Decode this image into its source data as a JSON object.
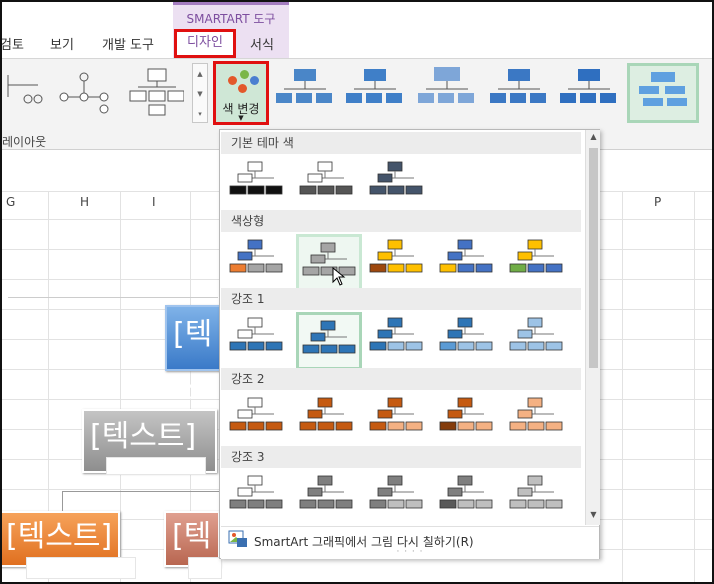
{
  "ribbon_tabs": {
    "review": "검토",
    "view": "보기",
    "developer": "개발 도구",
    "context_group": "SMARTART 도구",
    "design": "디자인",
    "format": "서식"
  },
  "ribbon": {
    "layouts_group": "레이아웃",
    "change_colors": "색 변경"
  },
  "sheet": {
    "columns": [
      "G",
      "H",
      "I",
      "P"
    ],
    "smartart_text": "[텍스트]"
  },
  "gallery": {
    "sections": [
      {
        "title": "기본 테마 색",
        "colors": [
          [
            "#ffffff",
            "#111111",
            "#111111"
          ],
          [
            "#ffffff",
            "#555555",
            "#555555"
          ],
          [
            "#44546a",
            "#44546a",
            "#44546a"
          ]
        ]
      },
      {
        "title": "색상형",
        "colors": [
          [
            "#4472c4",
            "#ed7d31",
            "#a5a5a5"
          ],
          [
            "#a5a5a5",
            "#a5a5a5",
            "#a5a5a5"
          ],
          [
            "#ffc000",
            "#9e480e",
            "#ffc000"
          ],
          [
            "#4472c4",
            "#ffc000",
            "#4472c4"
          ],
          [
            "#ffc000",
            "#70ad47",
            "#4472c4"
          ]
        ]
      },
      {
        "title": "강조 1",
        "colors": [
          [
            "#ffffff",
            "#2e75b6",
            "#2e75b6"
          ],
          [
            "#2e75b6",
            "#2e75b6",
            "#2e75b6"
          ],
          [
            "#2e75b6",
            "#2e75b6",
            "#9dc3e6"
          ],
          [
            "#2e75b6",
            "#5b9bd5",
            "#9dc3e6"
          ],
          [
            "#9dc3e6",
            "#9dc3e6",
            "#9dc3e6"
          ]
        ]
      },
      {
        "title": "강조 2",
        "colors": [
          [
            "#ffffff",
            "#c55a11",
            "#c55a11"
          ],
          [
            "#c55a11",
            "#c55a11",
            "#c55a11"
          ],
          [
            "#c55a11",
            "#c55a11",
            "#f4b183"
          ],
          [
            "#c55a11",
            "#843c0c",
            "#f4b183"
          ],
          [
            "#f4b183",
            "#f4b183",
            "#f4b183"
          ]
        ]
      },
      {
        "title": "강조 3",
        "colors": [
          [
            "#ffffff",
            "#7f7f7f",
            "#7f7f7f"
          ],
          [
            "#7f7f7f",
            "#7f7f7f",
            "#7f7f7f"
          ],
          [
            "#7f7f7f",
            "#7f7f7f",
            "#bfbfbf"
          ],
          [
            "#7f7f7f",
            "#595959",
            "#bfbfbf"
          ],
          [
            "#bfbfbf",
            "#bfbfbf",
            "#bfbfbf"
          ]
        ]
      }
    ],
    "footer_command": "SmartArt 그래픽에서 그림 다시 칠하기(R)"
  },
  "icons": {
    "change_colors": "color-palette-icon",
    "footer": "recolor-pictures-icon",
    "pointer": "mouse-pointer-icon"
  }
}
